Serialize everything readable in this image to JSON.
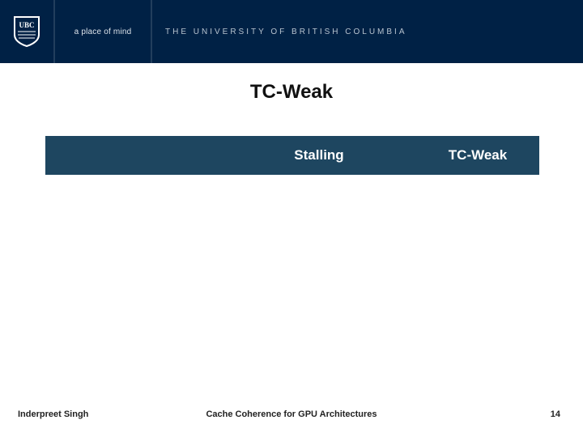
{
  "header": {
    "logo_text": "UBC",
    "tagline": "a place of mind",
    "university": "The University of British Columbia"
  },
  "title": "TC-Weak",
  "comparison_bar": {
    "col_left": "",
    "col_mid": "Stalling",
    "col_right": "TC-Weak"
  },
  "footer": {
    "author": "Inderpreet Singh",
    "talk_title": "Cache Coherence for GPU Architectures",
    "page_number": "14"
  }
}
